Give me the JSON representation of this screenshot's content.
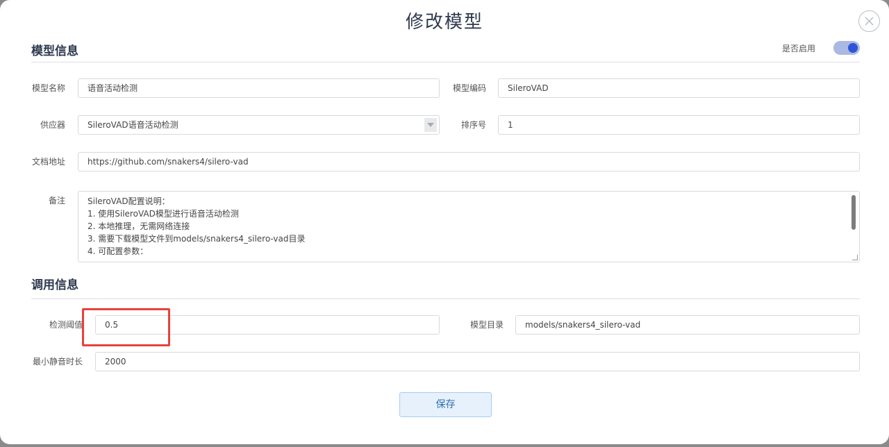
{
  "dialog": {
    "title": "修改模型",
    "save_label": "保存"
  },
  "model_info": {
    "section_title": "模型信息",
    "enabled_label": "是否启用",
    "enabled": true,
    "name_label": "模型名称",
    "name_value": "语音活动检测",
    "code_label": "模型编码",
    "code_value": "SileroVAD",
    "supplier_label": "供应器",
    "supplier_value": "SileroVAD语音活动检测",
    "sort_label": "排序号",
    "sort_value": "1",
    "doc_label": "文档地址",
    "doc_value": "https://github.com/snakers4/silero-vad",
    "remark_label": "备注",
    "remark_lines": [
      "SileroVAD配置说明：",
      "1. 使用SileroVAD模型进行语音活动检测",
      "2. 本地推理，无需网络连接",
      "3. 需要下载模型文件到models/snakers4_silero-vad目录",
      "4. 可配置参数："
    ]
  },
  "call_info": {
    "section_title": "调用信息",
    "threshold_label": "检测阈值",
    "threshold_value": "0.5",
    "model_dir_label": "模型目录",
    "model_dir_value": "models/snakers4_silero-vad",
    "min_silence_label": "最小静音时长",
    "min_silence_value": "2000"
  },
  "colors": {
    "toggle_on": "#2f54d8",
    "highlight": "#e8413a"
  }
}
